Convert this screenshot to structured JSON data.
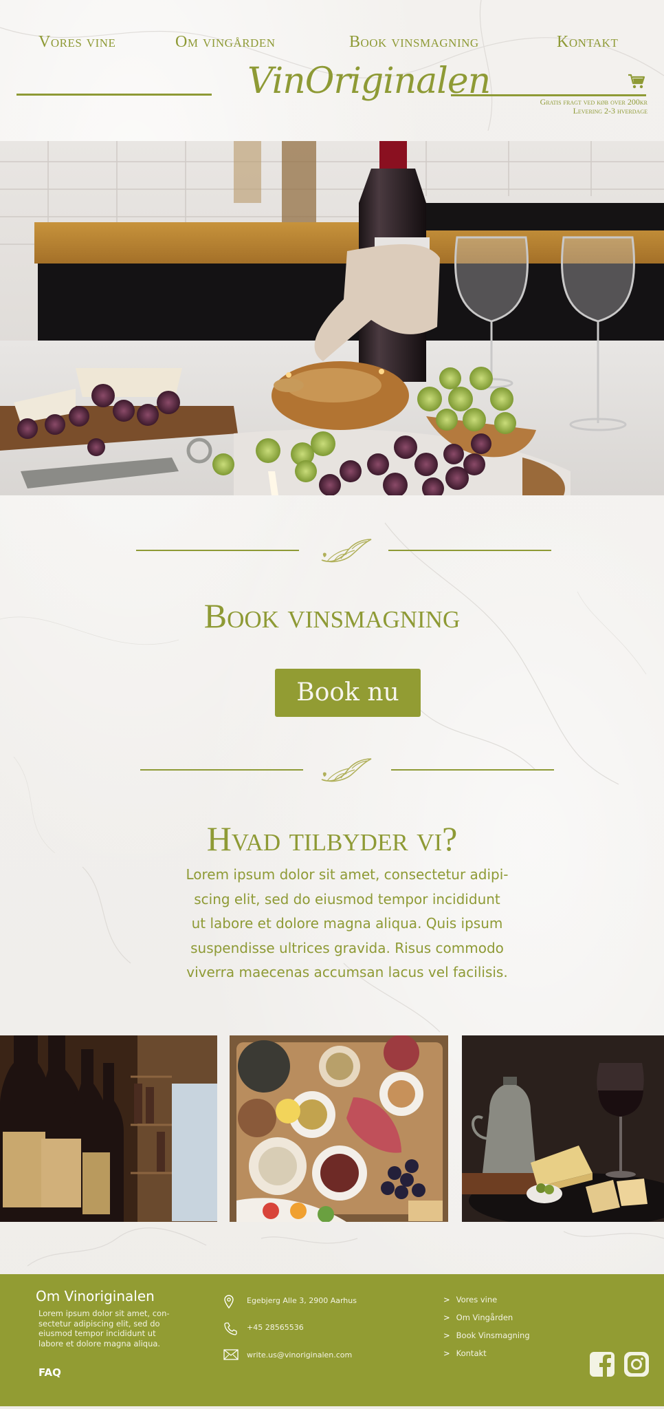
{
  "nav": {
    "items": [
      "Vores vine",
      "Om vingården",
      "Book vinsmagning",
      "Kontakt"
    ]
  },
  "brand": {
    "logo": "VinOriginalen",
    "accent_color": "#8e9a35"
  },
  "shipping": {
    "line1": "Gratis fragt ved køb over 200kr",
    "line2": "Levering 2-3 hverdage"
  },
  "icons": {
    "cart": "shopping-cart-icon",
    "flourish": "leaf-flourish-icon",
    "location": "map-pin-icon",
    "phone": "phone-icon",
    "mail": "mail-icon",
    "facebook": "facebook-icon",
    "instagram": "instagram-icon"
  },
  "booking": {
    "title": "Book vinsmagning",
    "button": "Book nu"
  },
  "offer": {
    "title": "Hvad tilbyder vi?",
    "lines": [
      "Lorem ipsum dolor sit amet, consectetur adipi-",
      "scing elit, sed do eiusmod tempor incididunt",
      "ut labore et dolore magna aliqua. Quis ipsum",
      "suspendisse ultrices gravida. Risus commodo",
      "viverra maecenas accumsan lacus vel facilisis."
    ]
  },
  "footer": {
    "title": "Om Vinoriginalen",
    "description": "Lorem ipsum dolor sit amet, con-sectetur adipiscing elit, sed do eiusmod tempor incididunt ut labore et dolore magna aliqua.",
    "faq": "FAQ",
    "address": "Egebjerg Alle 3, 2900 Aarhus",
    "phone": "+45 28565536",
    "email": "write.us@vinoriginalen.com",
    "links": [
      "Vores vine",
      "Om Vingården",
      "Book Vinsmagning",
      "Kontakt"
    ],
    "bg_color": "#929c33"
  }
}
